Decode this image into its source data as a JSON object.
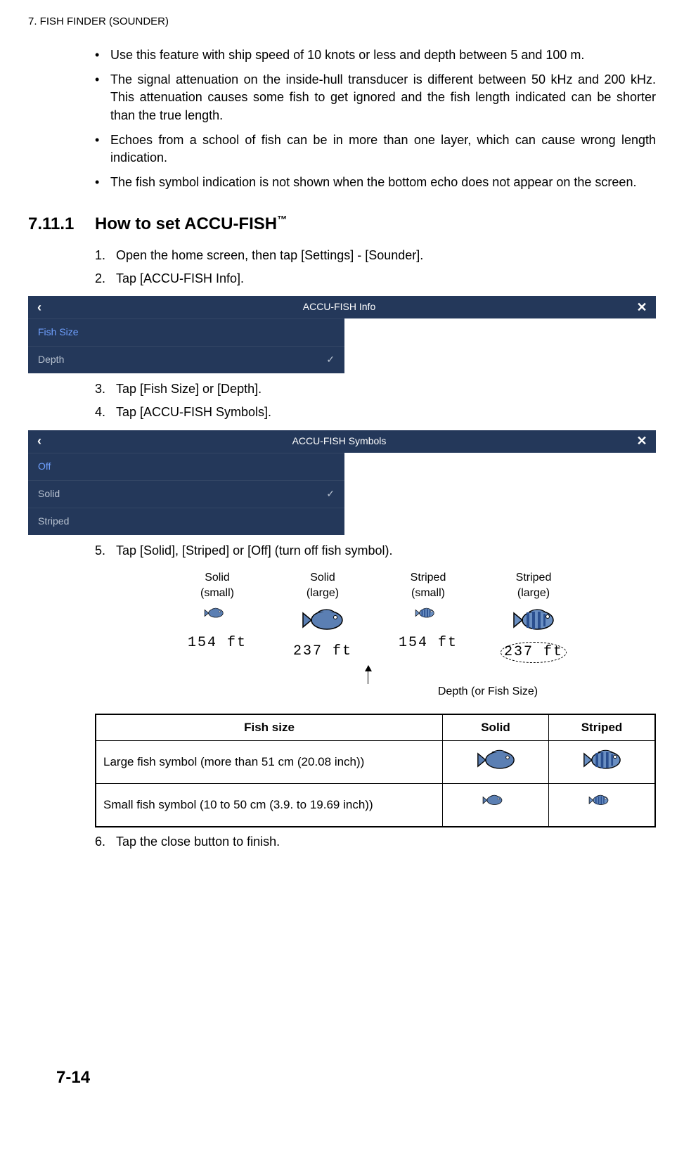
{
  "chapter_header": "7.  FISH FINDER (SOUNDER)",
  "bullets": [
    "Use this feature with ship speed of 10 knots or less and depth between 5 and 100 m.",
    "The signal attenuation on the inside-hull transducer is different between 50 kHz and 200 kHz. This attenuation causes some fish to get ignored and the fish length indicated can be shorter than the true length.",
    "Echoes from a school of fish can be in more than one layer, which can cause wrong length indication.",
    "The fish symbol indication is not shown when the bottom echo does not appear on the screen."
  ],
  "section": {
    "num": "7.11.1",
    "title": "How to set ACCU-FISH™"
  },
  "steps_a": {
    "s1": "Open the home screen, then tap [Settings] - [Sounder].",
    "s2": "Tap [ACCU-FISH Info]."
  },
  "panel1": {
    "title": "ACCU-FISH Info",
    "row1": "Fish Size",
    "row2": "Depth"
  },
  "steps_b": {
    "s3": "Tap [Fish Size] or [Depth].",
    "s4": "Tap [ACCU-FISH Symbols]."
  },
  "panel2": {
    "title": "ACCU-FISH Symbols",
    "row1": "Off",
    "row2": "Solid",
    "row3": "Striped"
  },
  "steps_c": {
    "s5": "Tap [Solid], [Striped] or [Off] (turn off fish symbol)."
  },
  "fishcols": {
    "c1_top": "Solid",
    "c1_sub": "(small)",
    "c1_val": "154 ft",
    "c2_top": "Solid",
    "c2_sub": "(large)",
    "c2_val": "237 ft",
    "c3_top": "Striped",
    "c3_sub": "(small)",
    "c3_val": "154 ft",
    "c4_top": "Striped",
    "c4_sub": "(large)",
    "c4_val": "237 ft"
  },
  "annot": "Depth (or Fish Size)",
  "table": {
    "h1": "Fish size",
    "h2": "Solid",
    "h3": "Striped",
    "r1": "Large fish symbol (more than 51 cm (20.08 inch))",
    "r2": "Small fish symbol (10 to 50 cm (3.9. to 19.69 inch))"
  },
  "steps_d": {
    "s6": "Tap the close button to finish."
  },
  "page_num": "7-14"
}
